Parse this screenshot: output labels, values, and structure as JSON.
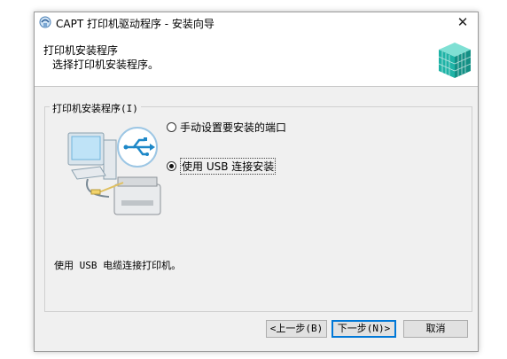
{
  "window": {
    "title": "CAPT 打印机驱动程序 - 安装向导",
    "close_glyph": "✕"
  },
  "header": {
    "title": "打印机安装程序",
    "subtitle": "选择打印机安装程序。"
  },
  "group": {
    "label": "打印机安装程序(I)",
    "options": [
      {
        "label": "手动设置要安装的端口",
        "selected": false
      },
      {
        "label": "使用 USB 连接安装",
        "selected": true
      }
    ]
  },
  "description": "使用 USB 电缆连接打印机。",
  "buttons": {
    "back": "<上一步(B)",
    "next": "下一步(N)>",
    "cancel": "取消"
  },
  "colors": {
    "focus_border": "#0078d7",
    "usb_circle": "#1e88c8",
    "logo_teal": "#1fb3a6"
  }
}
